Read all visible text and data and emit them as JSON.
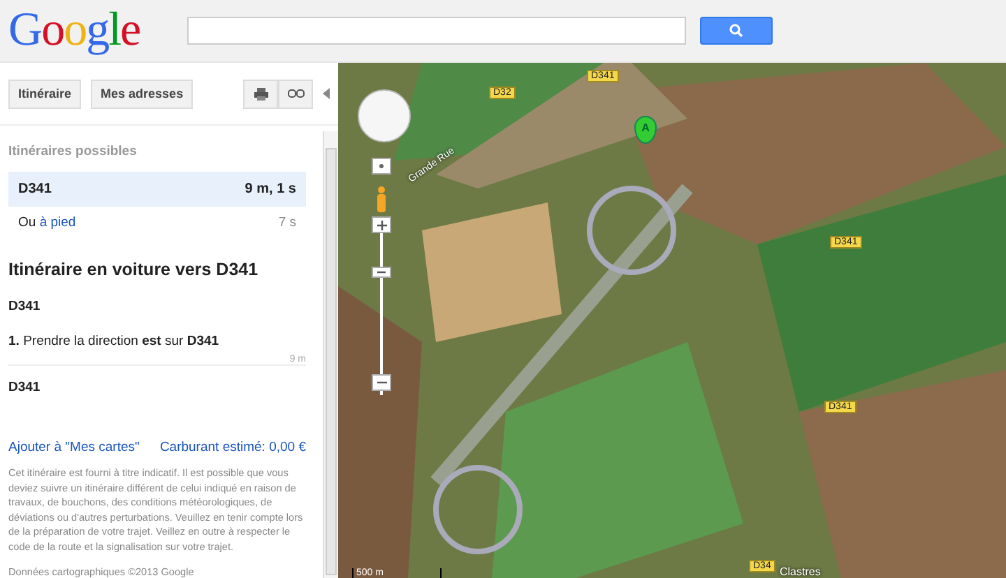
{
  "header": {
    "logo": "Google"
  },
  "toolbar": {
    "buttons": [
      "Itinéraire",
      "Mes adresses"
    ]
  },
  "routes": {
    "title": "Itinéraires possibles",
    "items": [
      {
        "name": "D341",
        "time": "9 m, 1 s",
        "selected": true
      }
    ],
    "alt": {
      "prefix": "Ou",
      "link": "à pied",
      "time": "7 s"
    }
  },
  "directions": {
    "title": "Itinéraire en voiture vers D341",
    "start": "D341",
    "steps": [
      {
        "text": "**1.** Prendre la direction **est** sur **D341**",
        "distance": "9 m"
      }
    ],
    "end": "D341"
  },
  "links": {
    "add": "Ajouter à \"Mes cartes\"",
    "fuel": "Carburant estimé: 0,00 €"
  },
  "disclaimer": "Cet itinéraire est fourni à titre indicatif. Il est possible que vous deviez suivre un itinéraire différent de celui indiqué en raison de travaux, de bouchons, des conditions météorologiques, de déviations ou d'autres perturbations. Veuillez en tenir compte lors de la préparation de votre trajet. Veillez en outre à respecter le code de la route et la signalisation sur votre trajet.",
  "copyright": "Données cartographiques ©2013 Google",
  "map": {
    "labels": [
      {
        "text": "D341",
        "kind": "shield"
      },
      {
        "text": "D32",
        "kind": "shield"
      },
      {
        "text": "Grande Rue",
        "kind": "street"
      },
      {
        "text": "D341",
        "kind": "shield"
      },
      {
        "text": "D341",
        "kind": "shield"
      },
      {
        "text": "D34",
        "kind": "shield"
      },
      {
        "text": "Clastres",
        "kind": "place"
      }
    ],
    "marker": "A",
    "scale": "500 m"
  }
}
